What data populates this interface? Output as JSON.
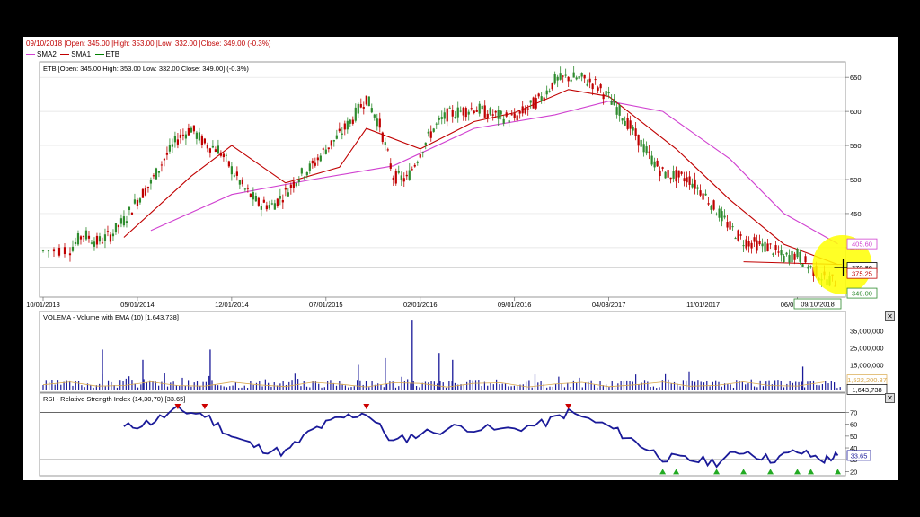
{
  "header": {
    "date": "09/10/2018",
    "ohlc_text": "|Open: 345.00 |High: 353.00 |Low: 332.00 |Close: 349.00 (-0.3%)"
  },
  "legend": [
    {
      "label": "SMA2",
      "color": "#d040d0"
    },
    {
      "label": "SMA1",
      "color": "#c00000"
    },
    {
      "label": "ETB",
      "color": "#008000"
    }
  ],
  "colors": {
    "up": "#2e8b2e",
    "down": "#c00000",
    "sma1": "#c00000",
    "sma2": "#d040d0",
    "volume": "#1a1a99",
    "rsi": "#1a1a99",
    "vol_ema": "#d9a84a"
  },
  "icons": {
    "close": "close-x-icon",
    "crosshair": "crosshair-icon",
    "highlight": "yellow-circle-highlight",
    "overbought": "red-triangle-down-icon",
    "oversold": "green-triangle-up-icon"
  },
  "price_panel": {
    "title": "ETB [Open: 345.00  High: 353.00  Low: 332.00  Close: 349.00] (-0.3%)",
    "y_ticks": [
      "650",
      "600",
      "550",
      "500",
      "450",
      "400"
    ],
    "price_labels": [
      {
        "text": "405.60",
        "value": 405.6,
        "color": "#d040d0"
      },
      {
        "text": "370.86",
        "value": 370.86,
        "color": "#000000"
      },
      {
        "text": "375.25",
        "value": 375.25,
        "color": "#c00000"
      },
      {
        "text": "349.00",
        "value": 349.0,
        "color": "#2e8b2e"
      }
    ],
    "x_ticks": [
      "10/01/2013",
      "05/01/2014",
      "12/01/2014",
      "07/01/2015",
      "02/01/2016",
      "09/01/2016",
      "04/03/2017",
      "11/01/2017",
      "06/01/2018"
    ],
    "last_date_label": "09/10/2018"
  },
  "volume_panel": {
    "title": "VOLEMA - Volume with EMA (10) [1,643,738]",
    "y_ticks": [
      "35,000,000",
      "25,000,000",
      "15,000,000"
    ],
    "labels": [
      "1,522,200.37",
      "1,643,738"
    ]
  },
  "rsi_panel": {
    "title": "RSI - Relative Strength Index (14,30,70) [33.65]",
    "y_ticks": [
      "70",
      "60",
      "50",
      "40",
      "30",
      "20"
    ],
    "value_label": "33.65"
  },
  "chart_data": {
    "type": "candlestick",
    "title": "ETB",
    "x_axis_dates": [
      "10/01/2013",
      "05/01/2014",
      "12/01/2014",
      "07/01/2015",
      "02/01/2016",
      "09/01/2016",
      "04/03/2017",
      "11/01/2017",
      "06/01/2018",
      "09/10/2018"
    ],
    "price_ylim": [
      330,
      670
    ],
    "close_series": [
      {
        "date": "2013-10",
        "close": 395
      },
      {
        "date": "2013-12",
        "close": 398
      },
      {
        "date": "2014-01",
        "close": 420
      },
      {
        "date": "2014-02",
        "close": 408
      },
      {
        "date": "2014-03",
        "close": 418
      },
      {
        "date": "2014-04",
        "close": 440
      },
      {
        "date": "2014-05",
        "close": 470
      },
      {
        "date": "2014-06",
        "close": 495
      },
      {
        "date": "2014-07",
        "close": 530
      },
      {
        "date": "2014-08",
        "close": 560
      },
      {
        "date": "2014-09",
        "close": 575
      },
      {
        "date": "2014-10",
        "close": 552
      },
      {
        "date": "2014-11",
        "close": 545
      },
      {
        "date": "2014-12",
        "close": 515
      },
      {
        "date": "2015-01",
        "close": 485
      },
      {
        "date": "2015-02",
        "close": 465
      },
      {
        "date": "2015-03",
        "close": 462
      },
      {
        "date": "2015-04",
        "close": 480
      },
      {
        "date": "2015-05",
        "close": 505
      },
      {
        "date": "2015-06",
        "close": 520
      },
      {
        "date": "2015-07",
        "close": 545
      },
      {
        "date": "2015-08",
        "close": 565
      },
      {
        "date": "2015-09",
        "close": 590
      },
      {
        "date": "2015-10",
        "close": 620
      },
      {
        "date": "2015-11",
        "close": 580
      },
      {
        "date": "2015-12",
        "close": 505
      },
      {
        "date": "2016-01",
        "close": 500
      },
      {
        "date": "2016-02",
        "close": 540
      },
      {
        "date": "2016-03",
        "close": 575
      },
      {
        "date": "2016-04",
        "close": 595
      },
      {
        "date": "2016-05",
        "close": 600
      },
      {
        "date": "2016-06",
        "close": 605
      },
      {
        "date": "2016-07",
        "close": 598
      },
      {
        "date": "2016-08",
        "close": 592
      },
      {
        "date": "2016-09",
        "close": 590
      },
      {
        "date": "2016-10",
        "close": 605
      },
      {
        "date": "2016-11",
        "close": 620
      },
      {
        "date": "2016-12",
        "close": 645
      },
      {
        "date": "2017-01",
        "close": 650
      },
      {
        "date": "2017-02",
        "close": 648
      },
      {
        "date": "2017-03",
        "close": 640
      },
      {
        "date": "2017-04",
        "close": 620
      },
      {
        "date": "2017-05",
        "close": 595
      },
      {
        "date": "2017-06",
        "close": 565
      },
      {
        "date": "2017-07",
        "close": 535
      },
      {
        "date": "2017-08",
        "close": 510
      },
      {
        "date": "2017-09",
        "close": 505
      },
      {
        "date": "2017-10",
        "close": 500
      },
      {
        "date": "2017-11",
        "close": 480
      },
      {
        "date": "2017-12",
        "close": 455
      },
      {
        "date": "2018-01",
        "close": 430
      },
      {
        "date": "2018-02",
        "close": 410
      },
      {
        "date": "2018-03",
        "close": 405
      },
      {
        "date": "2018-04",
        "close": 400
      },
      {
        "date": "2018-05",
        "close": 385
      },
      {
        "date": "2018-06",
        "close": 390
      },
      {
        "date": "2018-07",
        "close": 370
      },
      {
        "date": "2018-08",
        "close": 355
      },
      {
        "date": "2018-09",
        "close": 349
      }
    ],
    "sma1_series": [
      {
        "date": "2014-04",
        "value": 415
      },
      {
        "date": "2014-09",
        "value": 505
      },
      {
        "date": "2014-12",
        "value": 550
      },
      {
        "date": "2015-04",
        "value": 495
      },
      {
        "date": "2015-08",
        "value": 518
      },
      {
        "date": "2015-10",
        "value": 575
      },
      {
        "date": "2016-02",
        "value": 545
      },
      {
        "date": "2016-06",
        "value": 585
      },
      {
        "date": "2016-09",
        "value": 598
      },
      {
        "date": "2017-01",
        "value": 632
      },
      {
        "date": "2017-04",
        "value": 622
      },
      {
        "date": "2017-09",
        "value": 545
      },
      {
        "date": "2018-01",
        "value": 470
      },
      {
        "date": "2018-05",
        "value": 405
      },
      {
        "date": "2018-09",
        "value": 375.25
      }
    ],
    "sma2_series": [
      {
        "date": "2014-06",
        "value": 425
      },
      {
        "date": "2014-12",
        "value": 478
      },
      {
        "date": "2015-06",
        "value": 500
      },
      {
        "date": "2015-12",
        "value": 520
      },
      {
        "date": "2016-06",
        "value": 575
      },
      {
        "date": "2016-12",
        "value": 595
      },
      {
        "date": "2017-04",
        "value": 615
      },
      {
        "date": "2017-08",
        "value": 600
      },
      {
        "date": "2018-01",
        "value": 530
      },
      {
        "date": "2018-05",
        "value": 450
      },
      {
        "date": "2018-09",
        "value": 405.6
      }
    ],
    "volume_ylim": [
      0,
      40000000
    ],
    "volume_spikes": [
      {
        "date": "2014-02",
        "volume": 24000000
      },
      {
        "date": "2014-05",
        "volume": 18000000
      },
      {
        "date": "2014-10",
        "volume": 24000000
      },
      {
        "date": "2015-09",
        "volume": 15000000
      },
      {
        "date": "2015-11",
        "volume": 19000000
      },
      {
        "date": "2016-01",
        "volume": 41000000
      },
      {
        "date": "2016-03",
        "volume": 22000000
      },
      {
        "date": "2016-04",
        "volume": 18000000
      },
      {
        "date": "2018-06",
        "volume": 14000000
      }
    ],
    "volume_last": 1643738,
    "volume_ema_last": 1522200.37,
    "rsi_ylim": [
      18,
      78
    ],
    "rsi_series": [
      {
        "date": "2014-04",
        "value": 57
      },
      {
        "date": "2014-06",
        "value": 62
      },
      {
        "date": "2014-08",
        "value": 72
      },
      {
        "date": "2014-10",
        "value": 68
      },
      {
        "date": "2014-12",
        "value": 50
      },
      {
        "date": "2015-02",
        "value": 40
      },
      {
        "date": "2015-04",
        "value": 36
      },
      {
        "date": "2015-06",
        "value": 55
      },
      {
        "date": "2015-08",
        "value": 65
      },
      {
        "date": "2015-10",
        "value": 70
      },
      {
        "date": "2015-12",
        "value": 45
      },
      {
        "date": "2016-02",
        "value": 52
      },
      {
        "date": "2016-05",
        "value": 58
      },
      {
        "date": "2016-08",
        "value": 55
      },
      {
        "date": "2016-11",
        "value": 60
      },
      {
        "date": "2017-01",
        "value": 70
      },
      {
        "date": "2017-04",
        "value": 58
      },
      {
        "date": "2017-06",
        "value": 45
      },
      {
        "date": "2017-08",
        "value": 32
      },
      {
        "date": "2017-10",
        "value": 30
      },
      {
        "date": "2017-12",
        "value": 28
      },
      {
        "date": "2018-02",
        "value": 38
      },
      {
        "date": "2018-04",
        "value": 30
      },
      {
        "date": "2018-06",
        "value": 37
      },
      {
        "date": "2018-08",
        "value": 30
      },
      {
        "date": "2018-09",
        "value": 33.65
      }
    ],
    "rsi_bands": [
      30,
      70
    ]
  }
}
